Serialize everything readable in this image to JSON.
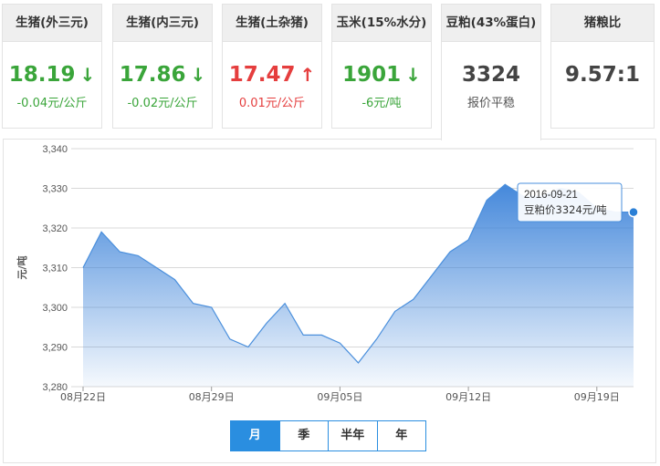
{
  "cards": [
    {
      "title": "生猪(外三元)",
      "value": "18.19",
      "trend": "down",
      "sub": "-0.04元/公斤"
    },
    {
      "title": "生猪(内三元)",
      "value": "17.86",
      "trend": "down",
      "sub": "-0.02元/公斤"
    },
    {
      "title": "生猪(土杂猪)",
      "value": "17.47",
      "trend": "up",
      "sub": "0.01元/公斤"
    },
    {
      "title": "玉米(15%水分)",
      "value": "1901",
      "trend": "down",
      "sub": "-6元/吨"
    },
    {
      "title": "豆粕(43%蛋白)",
      "value": "3324",
      "trend": "flat",
      "sub": "报价平稳"
    },
    {
      "title": "猪粮比",
      "value": "9.57:1",
      "trend": "none",
      "sub": ""
    }
  ],
  "colors": {
    "down": "#3aa53a",
    "up": "#e53e3e",
    "accent": "#2a8ee0",
    "area_top": "#3b82d9",
    "line": "#4a8fdc"
  },
  "icons": {
    "down": "arrow-down-icon",
    "up": "arrow-up-icon"
  },
  "tabs": [
    "月",
    "季",
    "半年",
    "年"
  ],
  "active_tab": 0,
  "tooltip": {
    "date": "2016-09-21",
    "text": "豆粕价3324元/吨"
  },
  "chart_data": {
    "type": "area",
    "ylabel": "元/吨",
    "ylim": [
      3280,
      3340
    ],
    "yticks": [
      3280,
      3290,
      3300,
      3310,
      3320,
      3330,
      3340
    ],
    "ytick_labels": [
      "3,280",
      "3,290",
      "3,300",
      "3,310",
      "3,320",
      "3,330",
      "3,340"
    ],
    "xticks": [
      "08月22日",
      "08月29日",
      "09月05日",
      "09月12日",
      "09月19日"
    ],
    "x": [
      "08-22",
      "08-23",
      "08-24",
      "08-25",
      "08-26",
      "08-27",
      "08-28",
      "08-29",
      "08-30",
      "08-31",
      "09-01",
      "09-02",
      "09-03",
      "09-04",
      "09-05",
      "09-06",
      "09-07",
      "09-08",
      "09-09",
      "09-10",
      "09-11",
      "09-12",
      "09-13",
      "09-14",
      "09-15",
      "09-16",
      "09-17",
      "09-18",
      "09-19",
      "09-20",
      "09-21"
    ],
    "values": [
      3310,
      3319,
      3314,
      3313,
      3310,
      3307,
      3301,
      3300,
      3292,
      3290,
      3296,
      3301,
      3293,
      3293,
      3291,
      3286,
      3292,
      3299,
      3302,
      3308,
      3314,
      3317,
      3327,
      3331,
      3328,
      3328,
      3330,
      3329,
      3325,
      3324,
      3324
    ],
    "grid": true,
    "legend": "none"
  }
}
